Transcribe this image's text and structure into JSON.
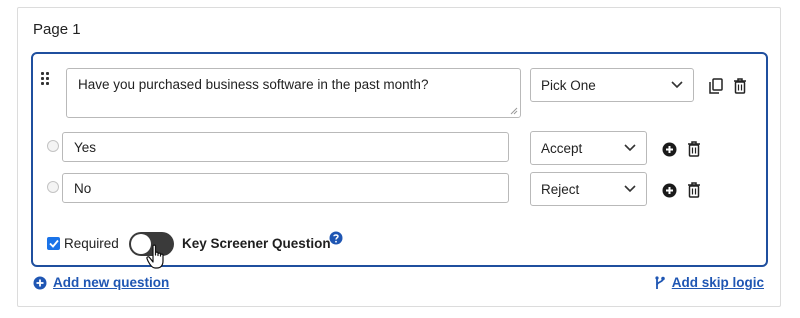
{
  "page": {
    "title": "Page 1"
  },
  "question": {
    "text": "Have you purchased business software in the past month?",
    "type": "Pick One",
    "options": [
      {
        "label": "Yes",
        "action": "Accept"
      },
      {
        "label": "No",
        "action": "Reject"
      }
    ],
    "required_label": "Required",
    "required_checked": true,
    "key_screener_label": "Key Screener Question",
    "key_screener_on": false
  },
  "footer": {
    "add_question": "Add new question",
    "add_skip_logic": "Add skip logic"
  },
  "colors": {
    "accent": "#1f4f9e",
    "link": "#1f56b3",
    "checkbox": "#1a73e8",
    "toggle_off": "#3a3a3a"
  },
  "icons": [
    "drag-handle-icon",
    "chevron-down-icon",
    "copy-icon",
    "trash-icon",
    "plus-circle-icon",
    "help-icon",
    "branch-icon",
    "hand-cursor-icon"
  ]
}
